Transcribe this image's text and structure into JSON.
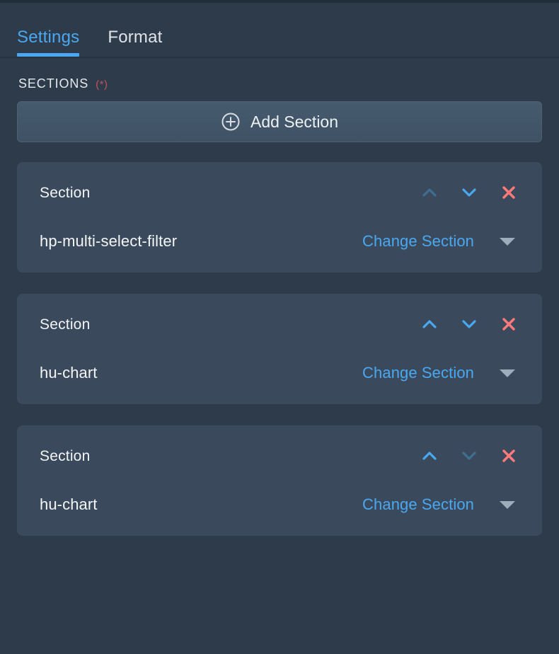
{
  "tabs": [
    {
      "label": "Settings",
      "active": true,
      "name": "tab-settings"
    },
    {
      "label": "Format",
      "active": false,
      "name": "tab-format"
    }
  ],
  "sections_panel": {
    "label": "SECTIONS",
    "required_mark": "(*)",
    "add_button": {
      "label": "Add Section",
      "icon": "plus-circle-icon"
    }
  },
  "colors": {
    "page_background": "#2e3b4b",
    "card_background": "#3a4a5c",
    "accent_blue": "#4aa8f0",
    "accent_blue_disabled": "#3f6e93",
    "danger_red": "#ff7b7b",
    "required_red": "#c0555c",
    "caret_grey": "#9fadbb",
    "text_primary": "#f2f4f6"
  },
  "cards": [
    {
      "title": "Section",
      "value": "hp-multi-select-filter",
      "change_label": "Change Section",
      "move_up_enabled": false,
      "move_down_enabled": true,
      "icons": {
        "up": "chevron-up-icon",
        "down": "chevron-down-icon",
        "remove": "close-x-icon",
        "dropdown": "caret-down-icon"
      }
    },
    {
      "title": "Section",
      "value": "hu-chart",
      "change_label": "Change Section",
      "move_up_enabled": true,
      "move_down_enabled": true,
      "icons": {
        "up": "chevron-up-icon",
        "down": "chevron-down-icon",
        "remove": "close-x-icon",
        "dropdown": "caret-down-icon"
      }
    },
    {
      "title": "Section",
      "value": "hu-chart",
      "change_label": "Change Section",
      "move_up_enabled": true,
      "move_down_enabled": false,
      "icons": {
        "up": "chevron-up-icon",
        "down": "chevron-down-icon",
        "remove": "close-x-icon",
        "dropdown": "caret-down-icon"
      }
    }
  ]
}
